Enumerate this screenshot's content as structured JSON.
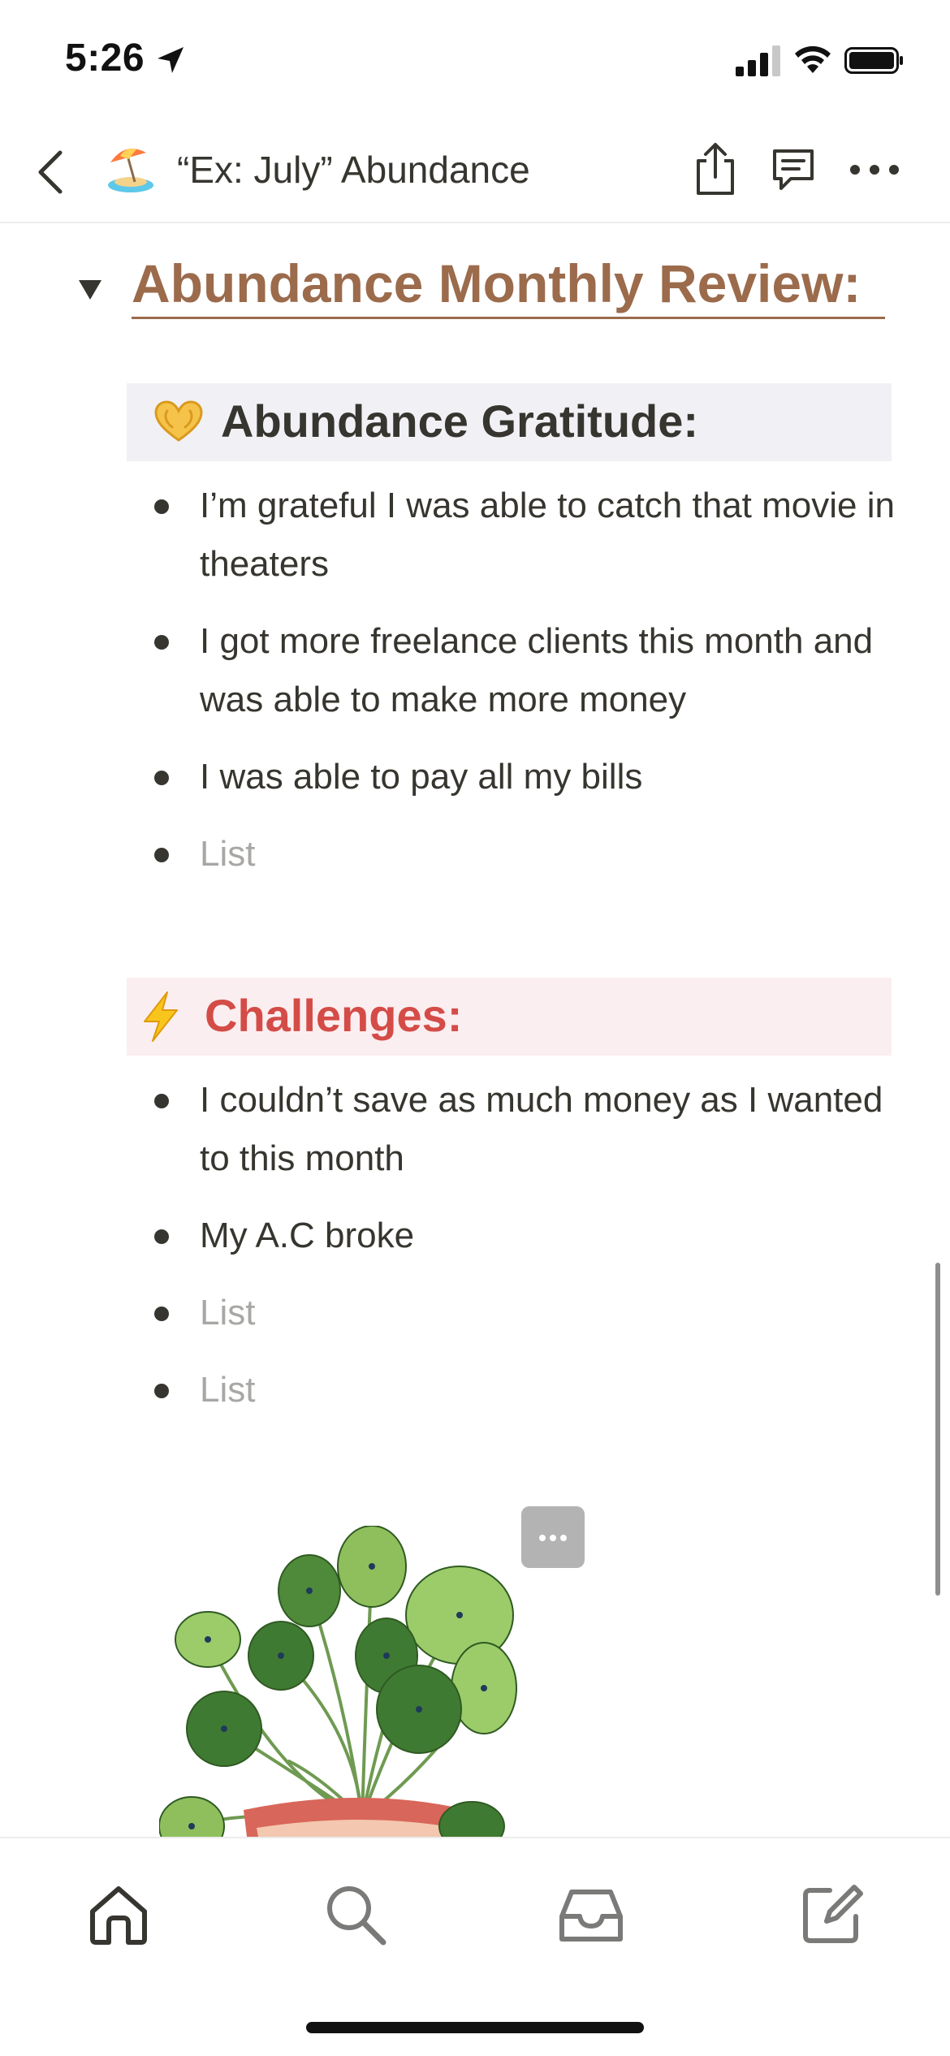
{
  "status_bar": {
    "time": "5:26",
    "icons": [
      "location-arrow-icon",
      "signal-icon",
      "wifi-icon",
      "battery-icon"
    ]
  },
  "nav": {
    "title": "“Ex: July” Abundance",
    "page_icon": "beach-umbrella-emoji",
    "actions": [
      "back-icon",
      "share-icon",
      "comment-icon",
      "more-icon"
    ]
  },
  "content": {
    "heading": "Abundance Monthly Review:",
    "heading_color": "#9b6b4c",
    "gratitude": {
      "icon": "heart-hands-emoji",
      "title": "Abundance Gratitude:",
      "background": "#f1f1f5",
      "items": [
        {
          "text": "I’m grateful I was able to catch that movie in theaters",
          "placeholder": false
        },
        {
          "text": "I got more freelance clients this month and was able to make more money",
          "placeholder": false
        },
        {
          "text": "I was able to pay all my bills",
          "placeholder": false
        },
        {
          "text": "List",
          "placeholder": true
        }
      ]
    },
    "challenges": {
      "icon": "lightning-emoji",
      "title": "Challenges:",
      "title_color": "#d44c47",
      "background": "#fbeef0",
      "items": [
        {
          "text": "I couldn’t save as much money as I wanted to this month",
          "placeholder": false
        },
        {
          "text": "My A.C broke",
          "placeholder": false
        },
        {
          "text": "List",
          "placeholder": true
        },
        {
          "text": "List",
          "placeholder": true
        }
      ]
    },
    "image": "potted-plant-illustration"
  },
  "tab_bar": {
    "tabs": [
      "home-icon",
      "search-icon",
      "inbox-icon",
      "new-page-icon"
    ]
  }
}
